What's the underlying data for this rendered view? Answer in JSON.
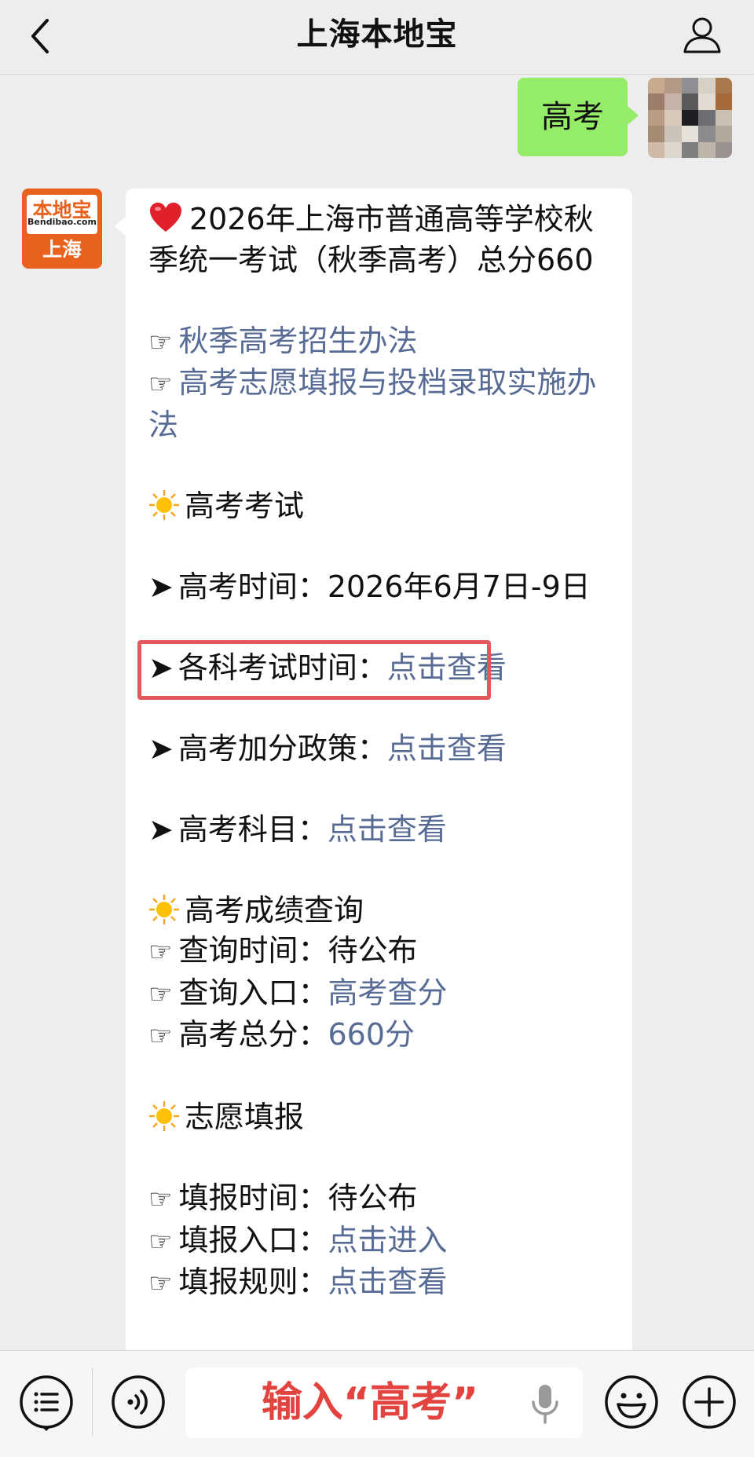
{
  "header": {
    "title": "上海本地宝"
  },
  "user_message": {
    "text": "高考"
  },
  "bot": {
    "avatar": {
      "logo": "本地宝",
      "sub": "Bendibao.com",
      "city": "上海"
    },
    "intro": "2026年上海市普通高等学校秋季统一考试（秋季高考）总分660",
    "links_top": [
      "秋季高考招生办法",
      "高考志愿填报与投档录取实施办法"
    ],
    "section_exam": {
      "heading": "高考考试",
      "time_label": "高考时间：",
      "time_value": "2026年6月7日-9日",
      "items": [
        {
          "label": "各科考试时间：",
          "link": "点击查看"
        },
        {
          "label": "高考加分政策：",
          "link": "点击查看"
        },
        {
          "label": "高考科目：",
          "link": "点击查看"
        }
      ]
    },
    "section_score": {
      "heading": "高考成绩查询",
      "query_time_label": "查询时间：",
      "query_time_value": "待公布",
      "entry_label": "查询入口：",
      "entry_link": "高考查分",
      "total_label": "高考总分：",
      "total_link": "660分"
    },
    "section_apply": {
      "heading": "志愿填报",
      "time_label": "填报时间：",
      "time_value": "待公布",
      "entry_label": "填报入口：",
      "entry_link": "点击进入",
      "rules_label": "填报规则：",
      "rules_link": "点击查看"
    }
  },
  "input": {
    "prompt": "输入“高考”"
  },
  "colors": {
    "link": "#576b95",
    "bubble_user": "#95ec69",
    "highlight": "#e3585a",
    "input_prompt": "#e3433f",
    "logo": "#e9621d"
  },
  "icons": [
    "back-icon",
    "user-icon",
    "menu-icon",
    "voice-icon",
    "mic-icon",
    "emoji-icon",
    "plus-icon",
    "heart-icon",
    "sun-icon",
    "pointing-hand-icon",
    "arrow-icon"
  ]
}
